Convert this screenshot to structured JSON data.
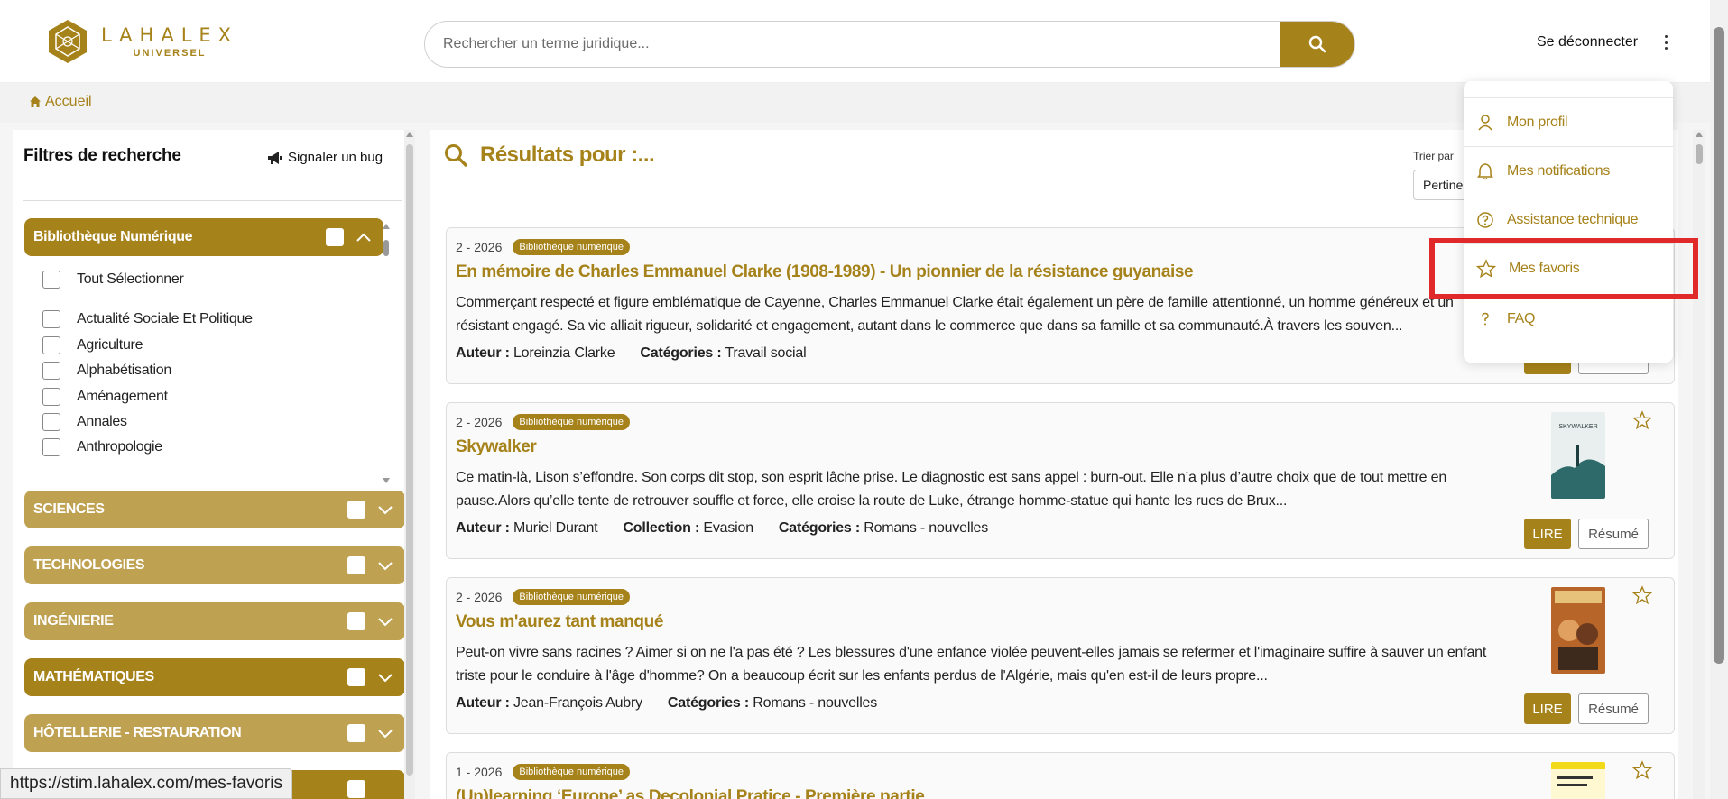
{
  "header": {
    "logo_word": "LAHALEX",
    "logo_sub": "UNIVERSEL",
    "search_placeholder": "Rechercher un terme juridique...",
    "logout": "Se déconnecter"
  },
  "breadcrumb": {
    "home": "Accueil"
  },
  "filters": {
    "title": "Filtres de recherche",
    "bug_label": "Signaler un bug",
    "open_category": "Bibliothèque Numérique",
    "select_all": "Tout Sélectionner",
    "items": [
      "Actualité Sociale Et Politique",
      "Agriculture",
      "Alphabétisation",
      "Aménagement",
      "Annales",
      "Anthropologie"
    ],
    "categories": [
      "SCIENCES",
      "TECHNOLOGIES",
      "INGÉNIERIE",
      "MATHÉMATIQUES",
      "HÔTELLERIE - RESTAURATION"
    ]
  },
  "results": {
    "title": "Résultats pour :...",
    "sort_label": "Trier par",
    "sort_value": "Pertinence",
    "read_label": "LIRE",
    "summary_label": "Résumé",
    "cards": [
      {
        "date": "2 - 2026",
        "badge": "Bibliothèque numérique",
        "title": "En mémoire de Charles Emmanuel Clarke (1908-1989) - Un pionnier de la résistance guyanaise",
        "desc": "Commerçant respecté et figure emblématique de Cayenne, Charles Emmanuel Clarke était également un père de famille attentionné, un homme généreux et un résistant engagé. Sa vie alliait rigueur, solidarité et engagement, autant dans le commerce que dans sa famille et sa communauté.À travers les souven...",
        "f1_label": "Auteur :",
        "f1_value": "Loreinzia Clarke",
        "f2_label": "Catégories :",
        "f2_value": "Travail social",
        "f3_label": "",
        "f3_value": ""
      },
      {
        "date": "2 - 2026",
        "badge": "Bibliothèque numérique",
        "title": "Skywalker",
        "desc": "Ce matin-là, Lison s’effondre. Son corps dit stop, son esprit lâche prise. Le diagnostic est sans appel : burn-out. Elle n’a plus d’autre choix que de tout mettre en pause.Alors qu’elle tente de retrouver souffle et force, elle croise la route de Luke, étrange homme-statue qui hante les rues de Brux...",
        "f1_label": "Auteur :",
        "f1_value": "Muriel Durant",
        "f2_label": "Collection :",
        "f2_value": "Evasion",
        "f3_label": "Catégories :",
        "f3_value": "Romans - nouvelles",
        "thumb_text": "SKYWALKER"
      },
      {
        "date": "2 - 2026",
        "badge": "Bibliothèque numérique",
        "title": "Vous m'aurez tant manqué",
        "desc": "Peut-on vivre sans racines ? Aimer si on ne l'a pas été ? Les blessures d'une enfance violée peuvent-elles jamais se refermer et l'imaginaire suffire à sauver un enfant triste pour le conduire à l'âge d'homme? On a beaucoup écrit sur les enfants perdus de l'Algérie, mais qu'en est-il de leurs propre...",
        "f1_label": "Auteur :",
        "f1_value": "Jean-François Aubry",
        "f2_label": "Catégories :",
        "f2_value": "Romans - nouvelles",
        "f3_label": "",
        "f3_value": ""
      },
      {
        "date": "1 - 2026",
        "badge": "Bibliothèque numérique",
        "title": "(Un)learning ‘Europe’ as Decolonial Pratice - Première partie"
      }
    ]
  },
  "menu": {
    "items": [
      "Mon profil",
      "Mes notifications",
      "Assistance technique",
      "Mes favoris",
      "FAQ"
    ]
  },
  "statusbar": {
    "url": "https://stim.lahalex.com/mes-favoris"
  },
  "colors": {
    "accent": "#a6821a",
    "accent_light": "#bfa152",
    "highlight": "#e02a2a"
  },
  "icons": {
    "search": "search-icon",
    "home": "home-icon",
    "megaphone": "megaphone-icon",
    "user": "user-icon",
    "bell": "bell-icon",
    "help": "help-circle-icon",
    "star": "star-icon",
    "question": "question-mark-icon"
  }
}
